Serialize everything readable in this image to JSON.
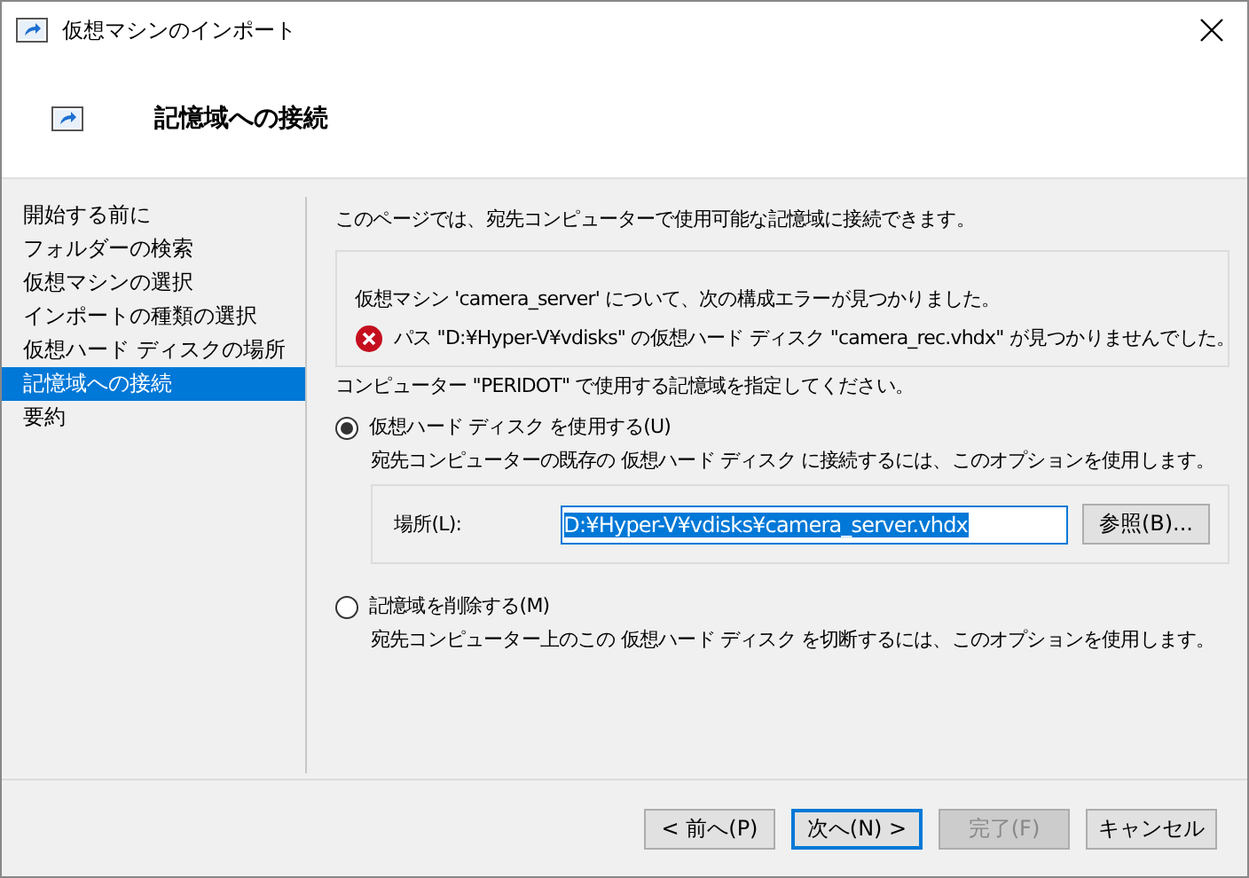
{
  "window": {
    "title": "仮想マシンのインポート"
  },
  "header": {
    "title": "記憶域への接続"
  },
  "steps": [
    {
      "label": "開始する前に",
      "selected": false
    },
    {
      "label": "フォルダーの検索",
      "selected": false
    },
    {
      "label": "仮想マシンの選択",
      "selected": false
    },
    {
      "label": "インポートの種類の選択",
      "selected": false
    },
    {
      "label": "仮想ハード ディスクの場所",
      "selected": false
    },
    {
      "label": "記憶域への接続",
      "selected": true
    },
    {
      "label": "要約",
      "selected": false
    }
  ],
  "intro": "このページでは、宛先コンピューターで使用可能な記憶域に接続できます。",
  "error_box": {
    "message": "仮想マシン 'camera_server' について、次の構成エラーが見つかりました。",
    "errors": [
      "パス \"D:¥Hyper-V¥vdisks\" の仮想ハード ディスク \"camera_rec.vhdx\" が見つかりませんでした。"
    ]
  },
  "prompt": "コンピューター \"PERIDOT\" で使用する記憶域を指定してください。",
  "options": [
    {
      "label": "仮想ハード ディスク を使用する(U)",
      "description": "宛先コンピューターの既存の 仮想ハード ディスク に接続するには、このオプションを使用します。",
      "selected": true,
      "location": {
        "label": "場所(L):",
        "value": "D:¥Hyper-V¥vdisks¥camera_server.vhdx",
        "browse": "参照(B)..."
      }
    },
    {
      "label": "記憶域を削除する(M)",
      "description": "宛先コンピューター上のこの 仮想ハード ディスク を切断するには、このオプションを使用します。",
      "selected": false
    }
  ],
  "buttons": [
    {
      "label": "< 前へ(P)",
      "disabled": false,
      "default": false
    },
    {
      "label": "次へ(N) >",
      "disabled": false,
      "default": true
    },
    {
      "label": "完了(F)",
      "disabled": true,
      "default": false
    },
    {
      "label": "キャンセル",
      "disabled": false,
      "default": false
    }
  ]
}
